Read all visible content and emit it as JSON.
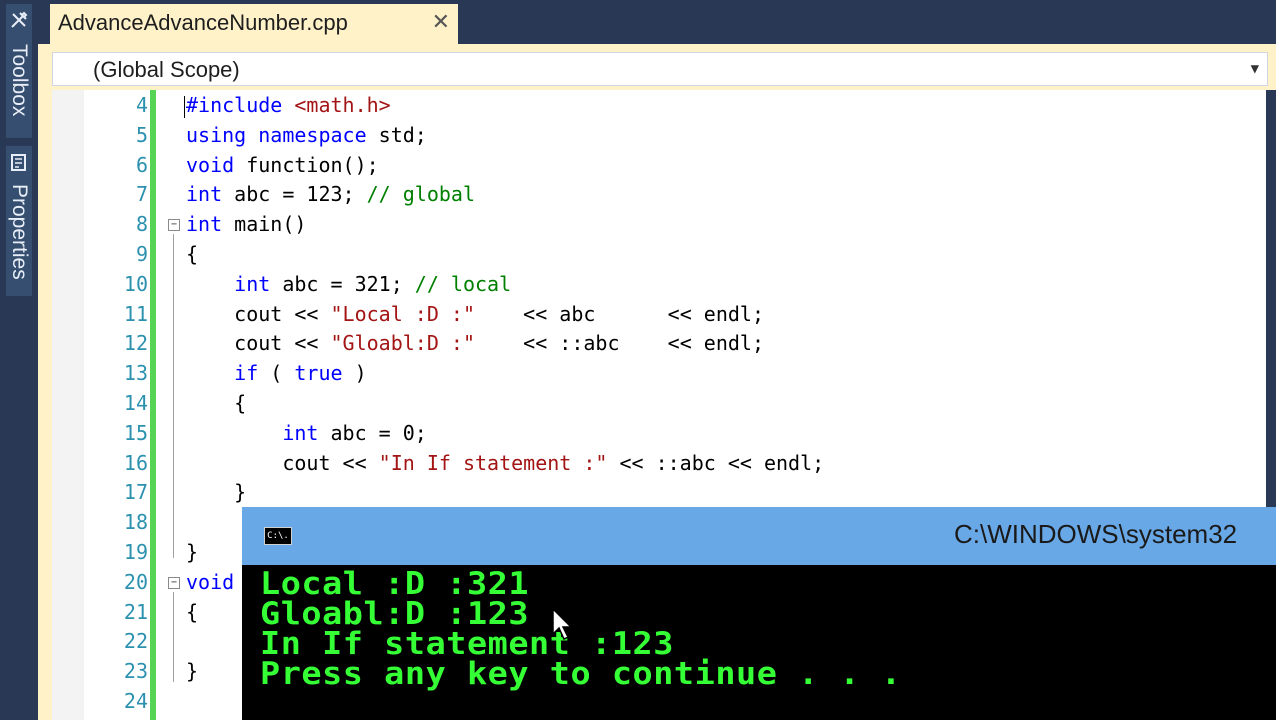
{
  "sidebar": {
    "toolbox_label": "Toolbox",
    "properties_label": "Properties"
  },
  "tab": {
    "title": "AdvanceAdvanceNumber.cpp",
    "close": "✕"
  },
  "scope": {
    "label": "(Global Scope)"
  },
  "code_lines": [
    {
      "num": "4",
      "text": "#include <math.h>"
    },
    {
      "num": "5",
      "text": "using namespace std;"
    },
    {
      "num": "6",
      "text": "void function();"
    },
    {
      "num": "7",
      "text": "int abc = 123; // global"
    },
    {
      "num": "8",
      "text": "int main()"
    },
    {
      "num": "9",
      "text": "{"
    },
    {
      "num": "10",
      "text": "    int abc = 321; // local"
    },
    {
      "num": "11",
      "text": "    cout << \"Local :D :\"    << abc      << endl;"
    },
    {
      "num": "12",
      "text": "    cout << \"Gloabl:D :\"    << ::abc    << endl;"
    },
    {
      "num": "13",
      "text": "    if ( true )"
    },
    {
      "num": "14",
      "text": "    {"
    },
    {
      "num": "15",
      "text": "        int abc = 0;"
    },
    {
      "num": "16",
      "text": "        cout << \"In If statement :\" << ::abc << endl;"
    },
    {
      "num": "17",
      "text": "    }"
    },
    {
      "num": "18",
      "text": ""
    },
    {
      "num": "19",
      "text": "}"
    },
    {
      "num": "20",
      "text": "void"
    },
    {
      "num": "21",
      "text": "{"
    },
    {
      "num": "22",
      "text": ""
    },
    {
      "num": "23",
      "text": "}"
    },
    {
      "num": "24",
      "text": ""
    }
  ],
  "console": {
    "icon_text": "C:\\.",
    "title": "C:\\WINDOWS\\system32",
    "output": [
      "Local :D :321",
      "Gloabl:D :123",
      "In If statement :123",
      "Press any key to continue . . ."
    ]
  },
  "colors": {
    "keyword": "#0000ff",
    "string": "#a31515",
    "comment": "#008000",
    "line_number": "#2b91af",
    "console_text": "#35ff35",
    "console_title": "#69a8e6"
  }
}
